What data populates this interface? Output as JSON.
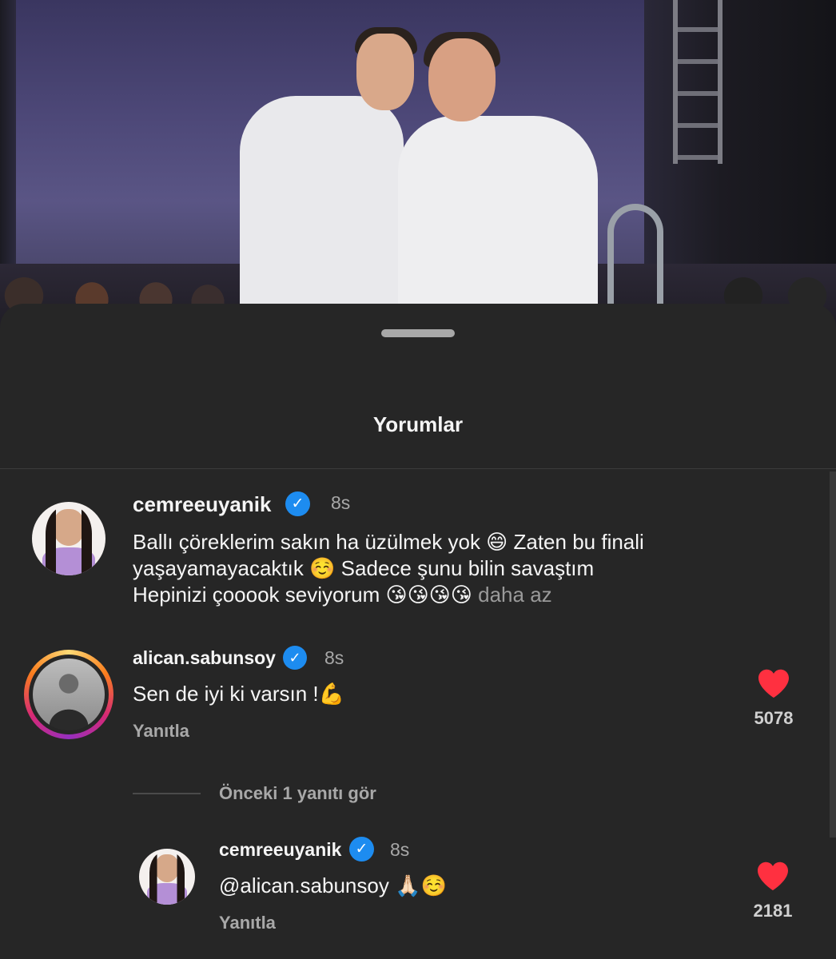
{
  "sheet": {
    "title": "Yorumlar"
  },
  "comments": [
    {
      "username": "cemreeuyanik",
      "verified": true,
      "time": "8s",
      "text_line1": "Ballı çöreklerim sakın ha üzülmek yok 😄 Zaten bu finali",
      "text_line2": "yaşayamayacaktık ☺️ Sadece şunu bilin savaştım",
      "text_line3": "Hepinizi çooook seviyorum 😘😘😘😘",
      "less_label": "daha az"
    },
    {
      "username": "alican.sabunsoy",
      "verified": true,
      "time": "8s",
      "text": "Sen de iyi ki varsın !💪",
      "reply_label": "Yanıtla",
      "like_count": "5078"
    }
  ],
  "replies": {
    "view_previous_label": "Önceki 1 yanıtı gör",
    "items": [
      {
        "username": "cemreeuyanik",
        "verified": true,
        "time": "8s",
        "text": "@alican.sabunsoy 🙏🏻☺️",
        "reply_label": "Yanıtla",
        "like_count": "2181"
      }
    ]
  },
  "colors": {
    "background": "#262626",
    "verified_badge": "#1d8cf0",
    "heart": "#ff3040",
    "muted_text": "#a8a8a8"
  },
  "icons": {
    "verified": "verified-badge-icon",
    "like": "heart-icon"
  }
}
